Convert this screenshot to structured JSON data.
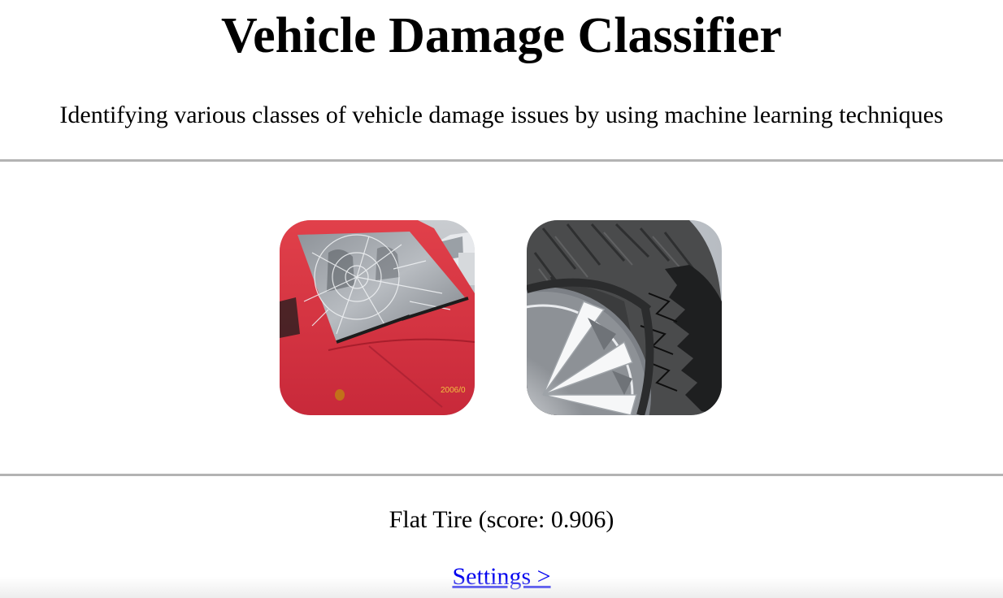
{
  "header": {
    "title": "Vehicle Damage Classifier",
    "subtitle": "Identifying various classes of vehicle damage issues by using machine learning techniques"
  },
  "gallery": {
    "images": [
      {
        "subject": "red car with shattered windshield",
        "stamp": "2006/0"
      },
      {
        "subject": "shredded flat tire on alloy wheel"
      }
    ]
  },
  "result": {
    "text": "Flat Tire (score: 0.906)"
  },
  "footer": {
    "settings_link": "Settings >"
  },
  "colors": {
    "rule": "#b3b3b3",
    "link": "#0000ee"
  }
}
